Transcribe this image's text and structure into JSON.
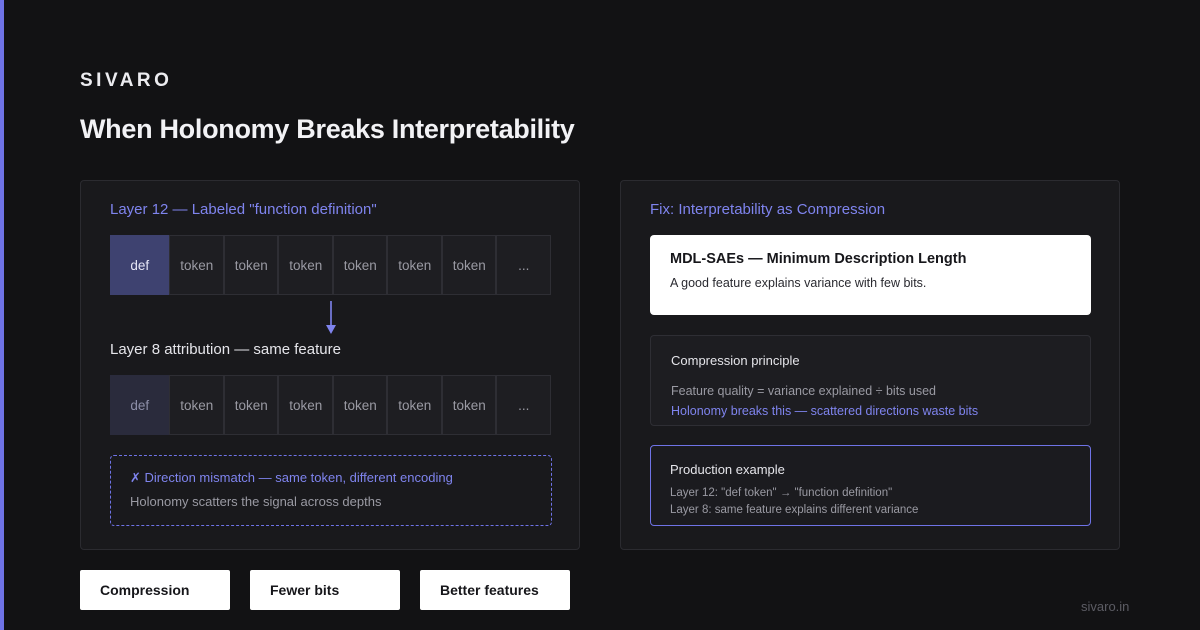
{
  "brand": "SIVARO",
  "title": "When Holonomy Breaks Interpretability",
  "left_panel": {
    "heading": "Layer 12 — Labeled \"function definition\"",
    "row1_tokens": [
      "def",
      "token",
      "token",
      "token",
      "token",
      "token",
      "token",
      "..."
    ],
    "sub_heading": "Layer 8 attribution — same feature",
    "row2_tokens": [
      "def",
      "token",
      "token",
      "token",
      "token",
      "token",
      "token",
      "..."
    ],
    "mismatch": {
      "title": "✗ Direction mismatch — same token, different encoding",
      "text": "Holonomy scatters the signal across depths"
    }
  },
  "right_panel": {
    "heading": "Fix: Interpretability as Compression",
    "mdl": {
      "title": "MDL-SAEs — Minimum Description Length",
      "text": "A good feature explains variance with few bits."
    },
    "principle": {
      "title": "Compression principle",
      "line1": "Feature quality = variance explained ÷ bits used",
      "line2": "Holonomy breaks this — scattered directions waste bits"
    },
    "production": {
      "title": "Production example",
      "line1": "Layer 12: \"def token\" → \"function definition\"",
      "line2": "Layer 8: same feature explains different variance"
    }
  },
  "chips": [
    "Compression",
    "Fewer bits",
    "Better features"
  ],
  "footer_url": "sivaro.in",
  "colors": {
    "background": "#121214",
    "accent": "#6f73e6",
    "highlight_token": "#3e4270",
    "panel": "#19191c"
  }
}
